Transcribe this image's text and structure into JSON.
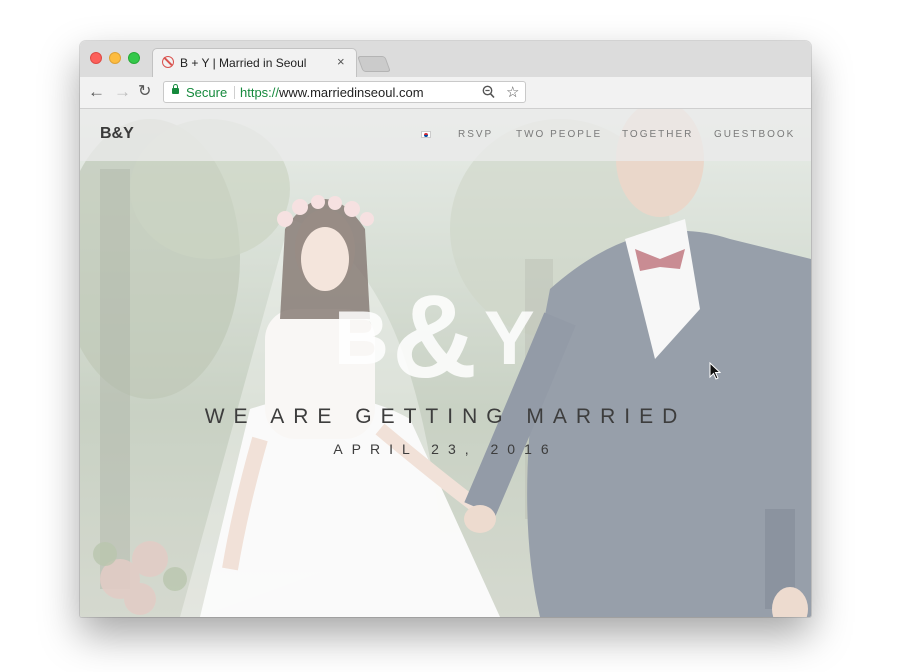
{
  "browser": {
    "tab": {
      "title": "B + Y | Married in Seoul",
      "close_glyph": "×",
      "favicon": "prohibited-icon"
    },
    "nav": {
      "back_glyph": "←",
      "forward_glyph": "→",
      "reload_glyph": "↻"
    },
    "address_bar": {
      "security_label": "Secure",
      "url_protocol": "https://",
      "url_host": "www.marriedinseoul.com",
      "zoom_icon": "zoom-icon",
      "bookmark_glyph": "☆"
    }
  },
  "site": {
    "logo": "B&Y",
    "language_flag": "korea-flag-icon",
    "nav": [
      {
        "label": "RSVP"
      },
      {
        "label": "TWO PEOPLE"
      },
      {
        "label": "TOGETHER"
      },
      {
        "label": "GUESTBOOK"
      }
    ],
    "hero": {
      "logo_b": "B",
      "logo_amp": "&",
      "logo_y": "Y",
      "tagline": "WE ARE GETTING MARRIED",
      "date": "APRIL 23, 2016"
    }
  },
  "colors": {
    "secure_green": "#168a3d",
    "nav_text": "#7a7a7a",
    "hero_text": "#3d3d3d"
  }
}
